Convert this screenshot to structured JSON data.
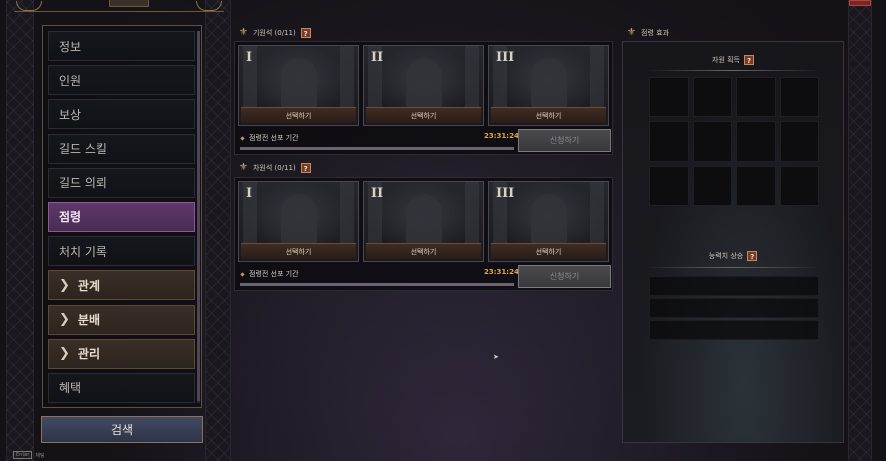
{
  "menu": {
    "items": [
      {
        "label": "정보",
        "type": "normal"
      },
      {
        "label": "인원",
        "type": "normal"
      },
      {
        "label": "보상",
        "type": "normal"
      },
      {
        "label": "길드 스킬",
        "type": "normal"
      },
      {
        "label": "길드 의뢰",
        "type": "normal"
      },
      {
        "label": "점령",
        "type": "active"
      },
      {
        "label": "처치 기록",
        "type": "normal"
      },
      {
        "label": "관계",
        "type": "group"
      },
      {
        "label": "분배",
        "type": "group"
      },
      {
        "label": "관리",
        "type": "group"
      },
      {
        "label": "혜택",
        "type": "normal"
      }
    ],
    "search_label": "검색"
  },
  "bottom_hint": {
    "key": "Enter",
    "label": "채팅"
  },
  "groups": [
    {
      "title": "기원석 (0/11)",
      "slots": [
        {
          "numeral": "I",
          "button": "선택하기"
        },
        {
          "numeral": "II",
          "button": "선택하기"
        },
        {
          "numeral": "III",
          "button": "선택하기"
        }
      ],
      "period_label": "점령전 선포 기간",
      "timer": "23:31:24",
      "progress": 1.0,
      "apply_label": "신청하기"
    },
    {
      "title": "차원석 (0/11)",
      "slots": [
        {
          "numeral": "I",
          "button": "선택하기"
        },
        {
          "numeral": "II",
          "button": "선택하기"
        },
        {
          "numeral": "III",
          "button": "선택하기"
        }
      ],
      "period_label": "점령전 선포 기간",
      "timer": "23:31:24",
      "progress": 1.0,
      "apply_label": "신청하기"
    }
  ],
  "effects": {
    "title": "점령 효과",
    "resource_label": "자원 획득",
    "stat_label": "능력치 상승"
  },
  "icons": {
    "help": "?",
    "chevron": "❯",
    "fleur": "⚜",
    "cursor": "➤"
  },
  "colors": {
    "active_menu": "#5e3869",
    "group_menu": "#3a2f27",
    "timer": "#e2a54a",
    "help_badge": "#7a3a2a"
  }
}
